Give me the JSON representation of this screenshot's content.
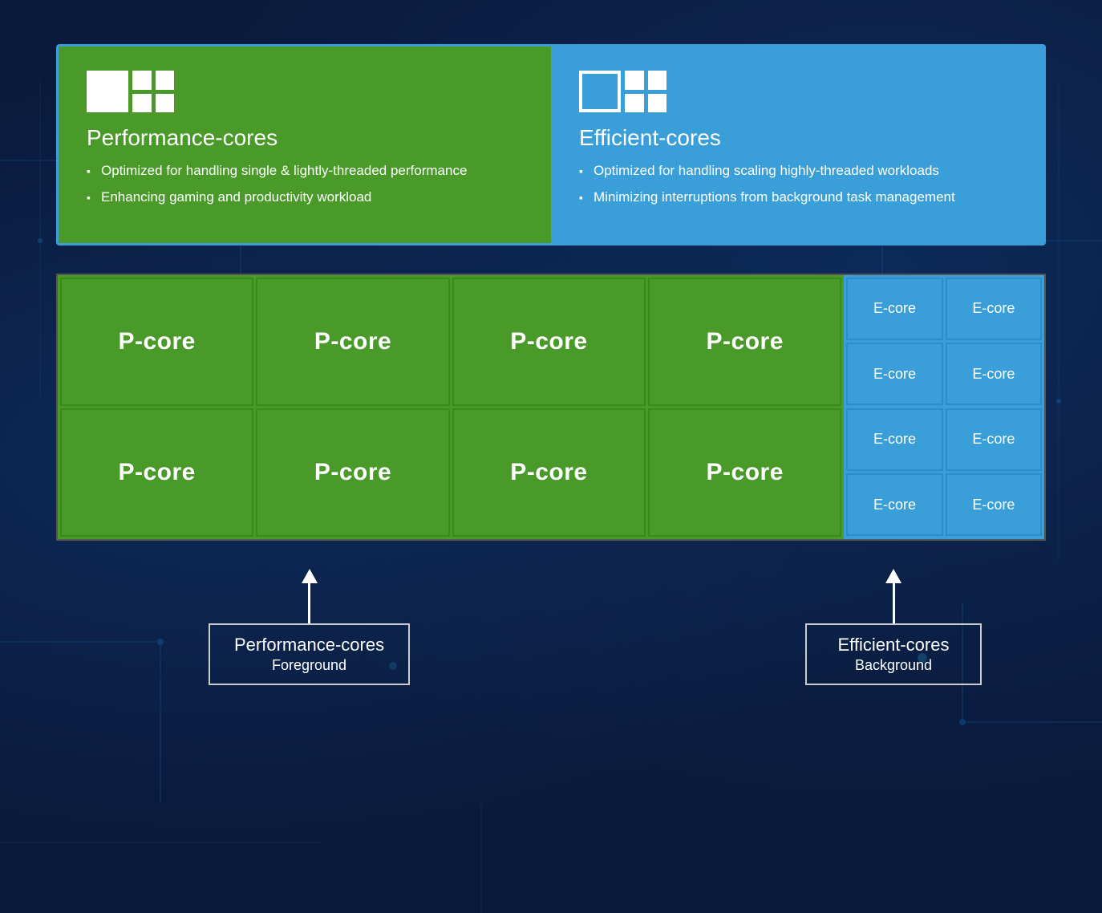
{
  "top": {
    "p_cores": {
      "title": "Performance-cores",
      "bullets": [
        "Optimized for handling single & lightly-threaded performance",
        "Enhancing gaming and productivity workload"
      ]
    },
    "e_cores": {
      "title": "Efficient-cores",
      "bullets": [
        "Optimized for handling scaling highly-threaded workloads",
        "Minimizing interruptions from background task management"
      ]
    }
  },
  "cpu": {
    "p_cores": [
      "P-core",
      "P-core",
      "P-core",
      "P-core",
      "P-core",
      "P-core",
      "P-core",
      "P-core"
    ],
    "e_cores": [
      "E-core",
      "E-core",
      "E-core",
      "E-core",
      "E-core",
      "E-core",
      "E-core",
      "E-core"
    ]
  },
  "labels": {
    "p_label_title": "Performance-cores",
    "p_label_subtitle": "Foreground",
    "e_label_title": "Efficient-cores",
    "e_label_subtitle": "Background"
  }
}
